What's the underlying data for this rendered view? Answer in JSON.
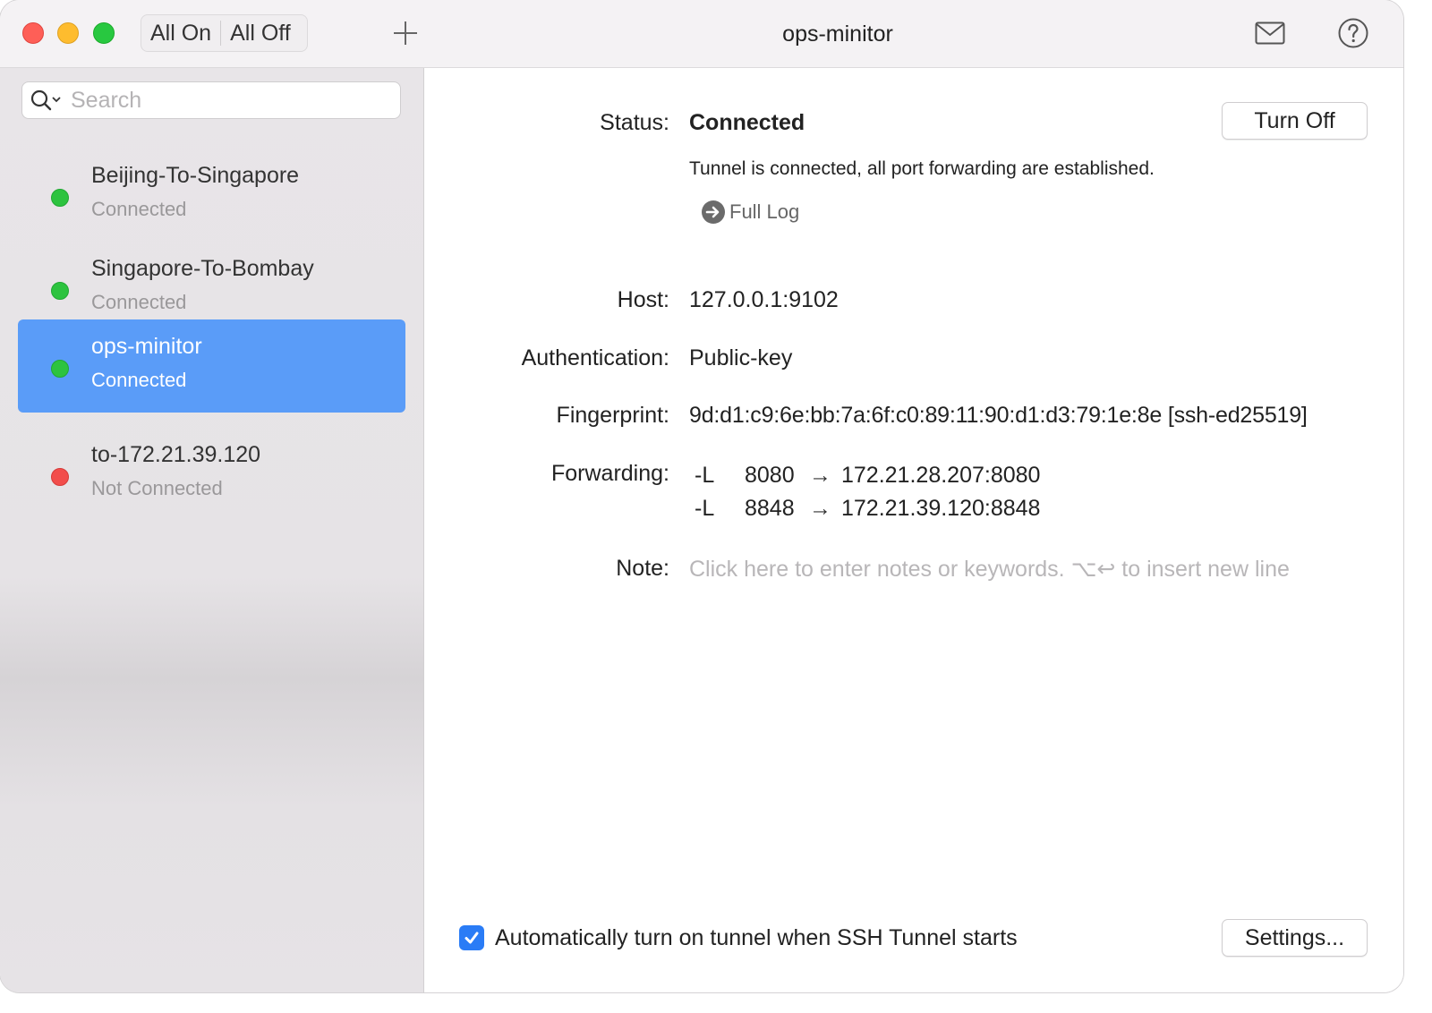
{
  "window": {
    "title": "ops-minitor",
    "all_on_label": "All On",
    "all_off_label": "All Off"
  },
  "sidebar": {
    "search_placeholder": "Search",
    "items": [
      {
        "name": "Beijing-To-Singapore",
        "status": "Connected",
        "indicator": "green",
        "selected": false
      },
      {
        "name": "Singapore-To-Bombay",
        "status": "Connected",
        "indicator": "green",
        "selected": false
      },
      {
        "name": "ops-minitor",
        "status": "Connected",
        "indicator": "green",
        "selected": true
      },
      {
        "name": "to-172.21.39.120",
        "status": "Not Connected",
        "indicator": "red",
        "selected": false
      }
    ]
  },
  "detail": {
    "status_label": "Status:",
    "status_value": "Connected",
    "turn_off_label": "Turn Off",
    "status_message": "Tunnel is connected, all port forwarding are established.",
    "full_log_label": "Full Log",
    "host_label": "Host:",
    "host_value": "127.0.0.1:9102",
    "auth_label": "Authentication:",
    "auth_value": "Public-key",
    "fingerprint_label": "Fingerprint:",
    "fingerprint_value": "9d:d1:c9:6e:bb:7a:6f:c0:89:11:90:d1:d3:79:1e:8e [ssh-ed25519]",
    "forwarding_label": "Forwarding:",
    "forwarding": [
      {
        "flag": "-L",
        "local": "8080",
        "arrow": "→",
        "remote": "172.21.28.207:8080"
      },
      {
        "flag": "-L",
        "local": "8848",
        "arrow": "→",
        "remote": "172.21.39.120:8848"
      }
    ],
    "note_label": "Note:",
    "note_placeholder": "Click here to enter notes or keywords. ⌥↩ to insert new line",
    "auto_start_label": "Automatically turn on tunnel when SSH Tunnel starts",
    "auto_start_checked": true,
    "settings_label": "Settings..."
  },
  "colors": {
    "selection": "#5a9cf8",
    "connected": "#2dc33f",
    "disconnected": "#f24d4b",
    "checkbox": "#2a7cf6"
  }
}
